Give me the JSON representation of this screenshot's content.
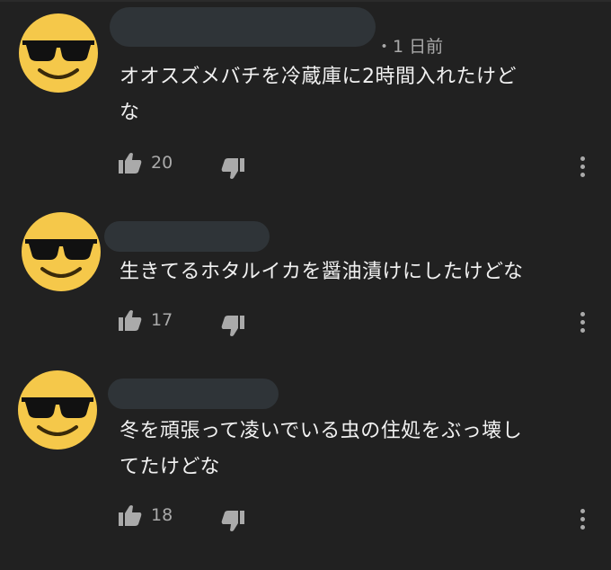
{
  "comments": [
    {
      "timestamp": "・1 日前",
      "text_lines": [
        "オオスズメバチを冷蔵庫に2時間入れたけど",
        "な"
      ],
      "likes": "20",
      "avatar_icon": "sunglasses-smiley-icon"
    },
    {
      "text_lines": [
        "生きてるホタルイカを醤油漬けにしたけどな"
      ],
      "likes": "17",
      "avatar_icon": "sunglasses-smiley-icon"
    },
    {
      "text_lines": [
        "冬を頑張って凌いでいる虫の住処をぶっ壊し",
        "てたけどな"
      ],
      "likes": "18",
      "avatar_icon": "sunglasses-smiley-icon"
    }
  ],
  "colors": {
    "background": "#212121",
    "avatar": "#f5c84a",
    "muted_text": "#aaaaaa",
    "blur_bar": "#2f3438"
  }
}
